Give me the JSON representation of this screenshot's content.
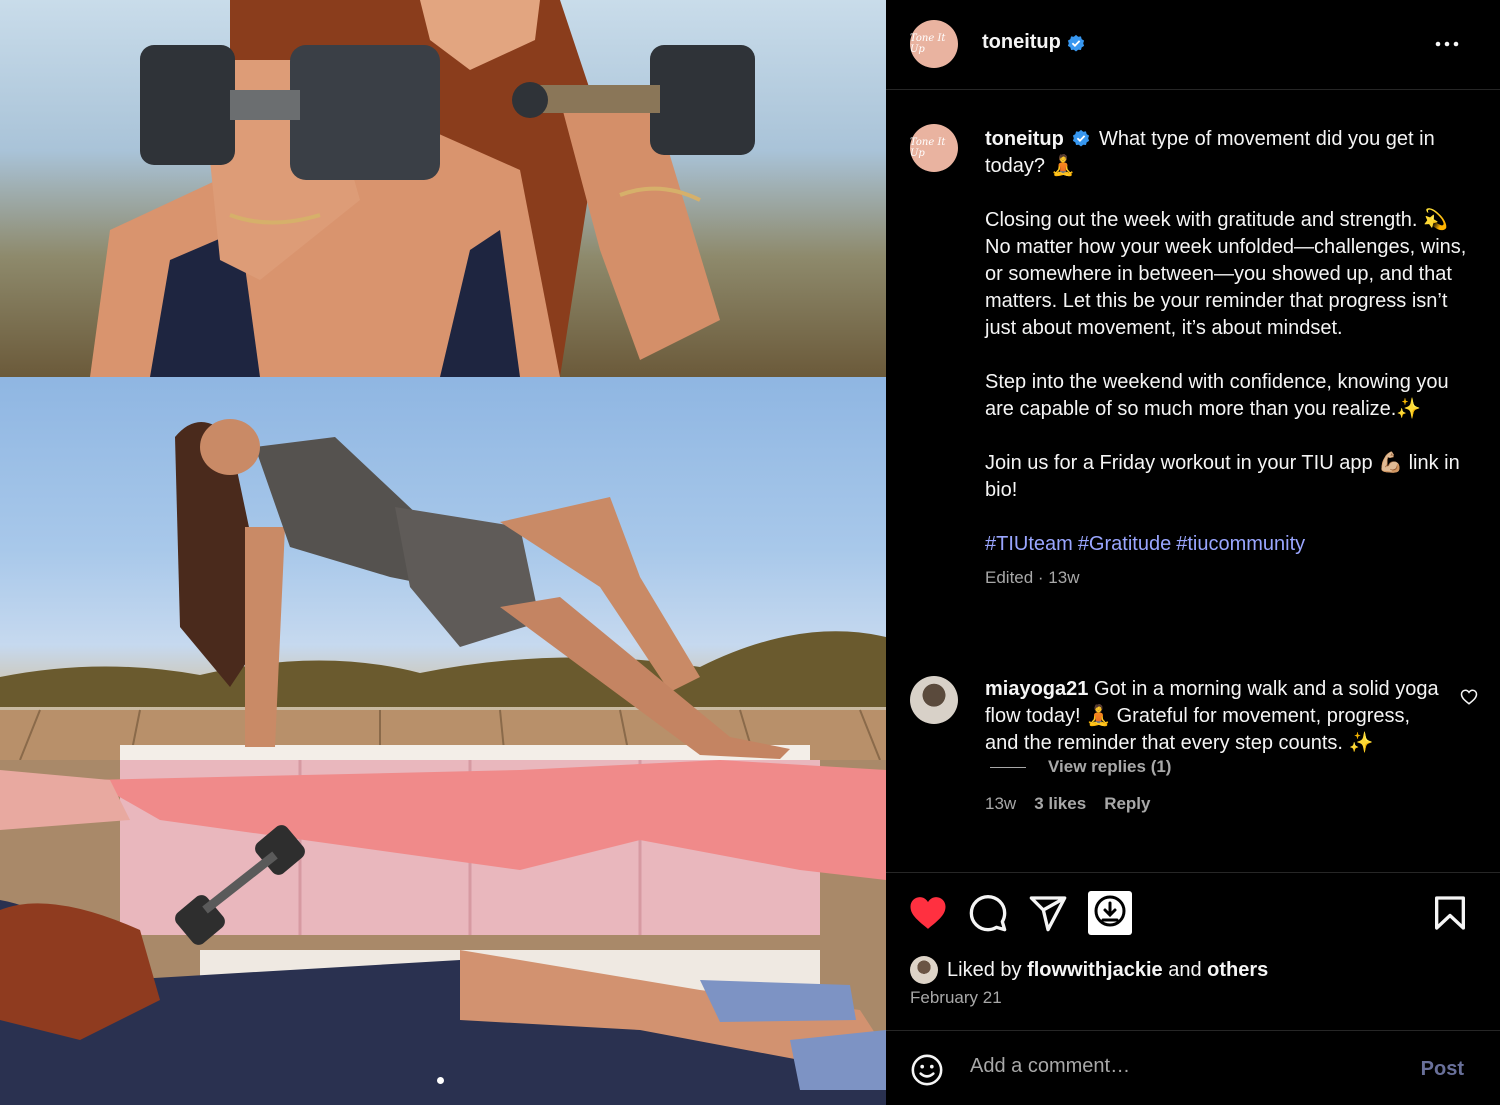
{
  "post": {
    "username": "toneitup",
    "avatar_text": "Tone It Up",
    "verified": true,
    "more_icon": "more-horizontal-icon"
  },
  "caption": {
    "username": "toneitup",
    "first_line": "What type of movement did you get in today? 🧘",
    "para2": "Closing out the week with gratitude and strength. 💫 No matter how your week unfolded—challenges, wins, or somewhere in between—you showed up, and that matters. Let this be your reminder that progress isn’t just about movement, it’s about mindset.",
    "para3": "Step into the weekend with confidence, knowing you are capable of so much more than you realize.✨",
    "para4": "Join us for a Friday workout in your TIU app 💪🏼 link in bio!",
    "hashtags": [
      "#TIUteam",
      "#Gratitude",
      "#tiucommunity"
    ],
    "meta": "Edited · 13w"
  },
  "comment": {
    "username": "miayoga21",
    "text": "Got in a morning walk and a solid yoga flow today! 🧘 Grateful for movement, progress, and the reminder that every step counts. ✨",
    "time": "13w",
    "likes": "3 likes",
    "reply": "Reply",
    "view_replies": "View replies (1)"
  },
  "likes": {
    "prefix": "Liked by",
    "user": "flowwithjackie",
    "and": "and",
    "others": "others",
    "date": "February 21"
  },
  "comment_bar": {
    "placeholder": "Add a comment…",
    "post_label": "Post"
  },
  "colors": {
    "background": "#000000",
    "heart": "#ff3040",
    "hashtag": "#9aa6ff",
    "verified": "#3797f0",
    "muted": "#a8a8a8"
  },
  "carousel": {
    "current": 1
  }
}
